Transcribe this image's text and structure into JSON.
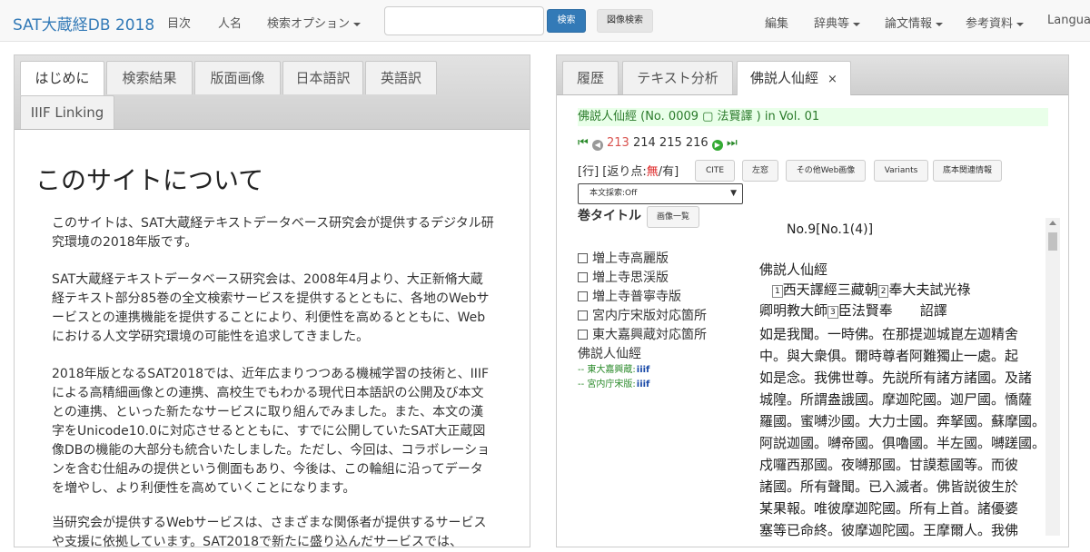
{
  "nav": {
    "brand": "SAT大蔵経DB 2018",
    "contents": "目次",
    "names": "人名",
    "search_options": "検索オプション",
    "search_placeholder": "",
    "search_button": "検索",
    "image_search_button": "図像検索",
    "edit": "編集",
    "dictionaries": "辞典等",
    "papers": "論文情報",
    "references": "参考資料",
    "language": "Languag"
  },
  "left_panel": {
    "tabs": [
      "はじめに",
      "検索結果",
      "版面画像",
      "日本語訳",
      "英語訳",
      "IIIF Linking"
    ],
    "title": "このサイトについて",
    "paragraphs": [
      "このサイトは、SAT大蔵経テキストデータベース研究会が提供するデジタル研究環境の2018年版です。",
      "SAT大蔵経テキストデータベース研究会は、2008年4月より、大正新脩大蔵経テキスト部分85巻の全文検索サービスを提供するとともに、各地のWebサービスとの連携機能を提供することにより、利便性を高めるとともに、Webにおける人文学研究環境の可能性を追求してきました。",
      "2018年版となるSAT2018では、近年広まりつつある機械学習の技術と、IIIFによる高精細画像との連携、高校生でもわかる現代日本語訳の公開及び本文との連携、といった新たなサービスに取り組んでみました。また、本文の漢字をUnicode10.0に対応させるとともに、すでに公開していたSAT大正蔵図像DBの機能の大部分も統合いたしました。ただし、今回は、コラボレーションを含む仕組みの提供という側面もあり、今後は、この輪組に沿ってデータを増やし、より利便性を高めていくことになります。",
      "当研究会が提供するWebサービスは、さまざまな関係者が提供するサービスや支援に依拠しています。SAT2018で新たに盛り込んだサービスでは、"
    ]
  },
  "right_panel": {
    "tabs": [
      "履歴",
      "テキスト分析",
      "佛説人仙經"
    ],
    "close_icon": "×",
    "sutra_header": "佛説人仙經 (No. 0009 ▢ 法賢譯 ) in Vol. 01",
    "pages": {
      "current": "213",
      "p2": "214",
      "p3": "215",
      "p4": "216"
    },
    "gyo_label": "[行]",
    "kaeri_label": "[返り点:",
    "kaeri_no": "無",
    "kaeri_yes": "/有]",
    "buttons": [
      "CITE",
      "左窓",
      "その他Web画像",
      "Variants",
      "底本関連情報"
    ],
    "search_select": "本文採索:Off",
    "maki_title": "巻タイトル",
    "image_list_button": "画像一覧",
    "checkboxes": [
      "増上寺高麗版",
      "増上寺思渓版",
      "増上寺普寧寺版",
      "宮内庁宋版対応箇所",
      "東大嘉興蔵対応箇所"
    ],
    "sutra_name": "佛説人仙經",
    "links": [
      "-- 東大嘉興蔵:",
      "-- 宮内庁宋版:"
    ],
    "iiif_logo": "iiif",
    "text": {
      "no": "No.9[No.1(4)]",
      "title": "佛説人仙經",
      "translator1_a": "西天譯經三藏朝",
      "translator1_b": "奉大夫試光祿",
      "translator2_a": "卿明教大師",
      "translator2_b": "臣法賢奉　　詔譯",
      "note1": "1",
      "note2": "2",
      "note3": "3",
      "lines": [
        "如是我聞。一時佛。在那提迦城崑左迦精舍",
        "中。與大衆俱。爾時尊者阿難獨止一處。起",
        "如是念。我佛世尊。先説所有諸方諸國。及諸",
        "城隍。所謂盎誐國。摩迦陀國。迦尸國。憍薩",
        "羅國。蜜嚩沙國。大力士國。奔拏國。蘇摩國。",
        "阿説迦國。嚩帝國。俱嚕國。半左國。嚩蹉國。",
        "戍囉西那國。夜嚩那國。甘謨惹國等。而彼",
        "諸國。所有聲聞。已入滅者。佛皆説彼生於",
        "某果報。唯彼摩迦陀國。所有上首。諸優婆",
        "塞等已命終。彼摩迦陀國。王摩爾人。我佛"
      ]
    }
  },
  "colors": {
    "brand": "#337ab7",
    "primary_button": "#337ab7",
    "current_page": "#d9534f",
    "header_bg": "#e9ffe9",
    "link_green": "#2a8a2a"
  }
}
